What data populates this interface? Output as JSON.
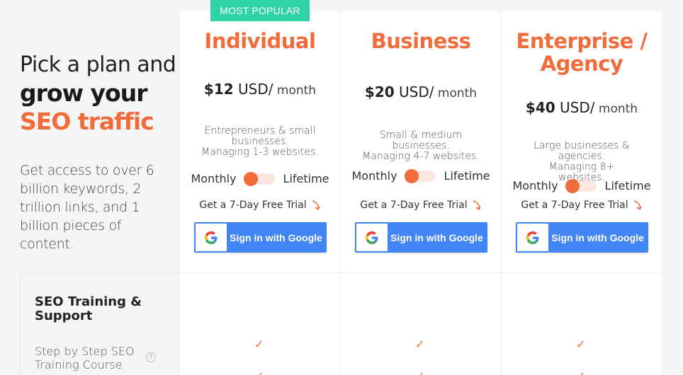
{
  "intro": {
    "line1": "Pick a plan and",
    "line2": "grow your",
    "line3": "SEO traffic",
    "description": "Get access to over 6 billion keywords, 2 trillion links, and 1 billion pieces of content."
  },
  "plans": [
    {
      "badge": "MOST POPULAR",
      "name": "Individual",
      "price_amount": "$12",
      "price_currency": " USD/",
      "price_period": " month",
      "sub_line1": "Entrepreneurs & small businesses.",
      "sub_line2": "Managing 1-3 websites.",
      "toggle_left": "Monthly",
      "toggle_right": "Lifetime",
      "trial": "Get a 7-Day Free Trial",
      "button_label": "Sign in with Google"
    },
    {
      "name": "Business",
      "price_amount": "$20",
      "price_currency": " USD/",
      "price_period": " month",
      "sub_line1": "Small & medium businesses.",
      "sub_line2": "Managing 4-7 websites.",
      "toggle_left": "Monthly",
      "toggle_right": "Lifetime",
      "trial": "Get a 7-Day Free Trial",
      "button_label": "Sign in with Google"
    },
    {
      "name": "Enterprise / Agency",
      "price_amount": "$40",
      "price_currency": " USD/",
      "price_period": " month",
      "sub_line1": "Large businesses & agencies.",
      "sub_line2": "Managing 8+ websites.",
      "toggle_left": "Monthly",
      "toggle_right": "Lifetime",
      "trial": "Get a 7-Day Free Trial",
      "button_label": "Sign in with Google"
    }
  ],
  "features": {
    "section_title": "SEO Training & Support",
    "item1": "Step by Step SEO Training Course",
    "help": "?"
  },
  "colors": {
    "accent": "#f26b3a",
    "badge": "#2fd3a6",
    "google_blue": "#4285f4"
  },
  "icons": {
    "check": "✓"
  }
}
